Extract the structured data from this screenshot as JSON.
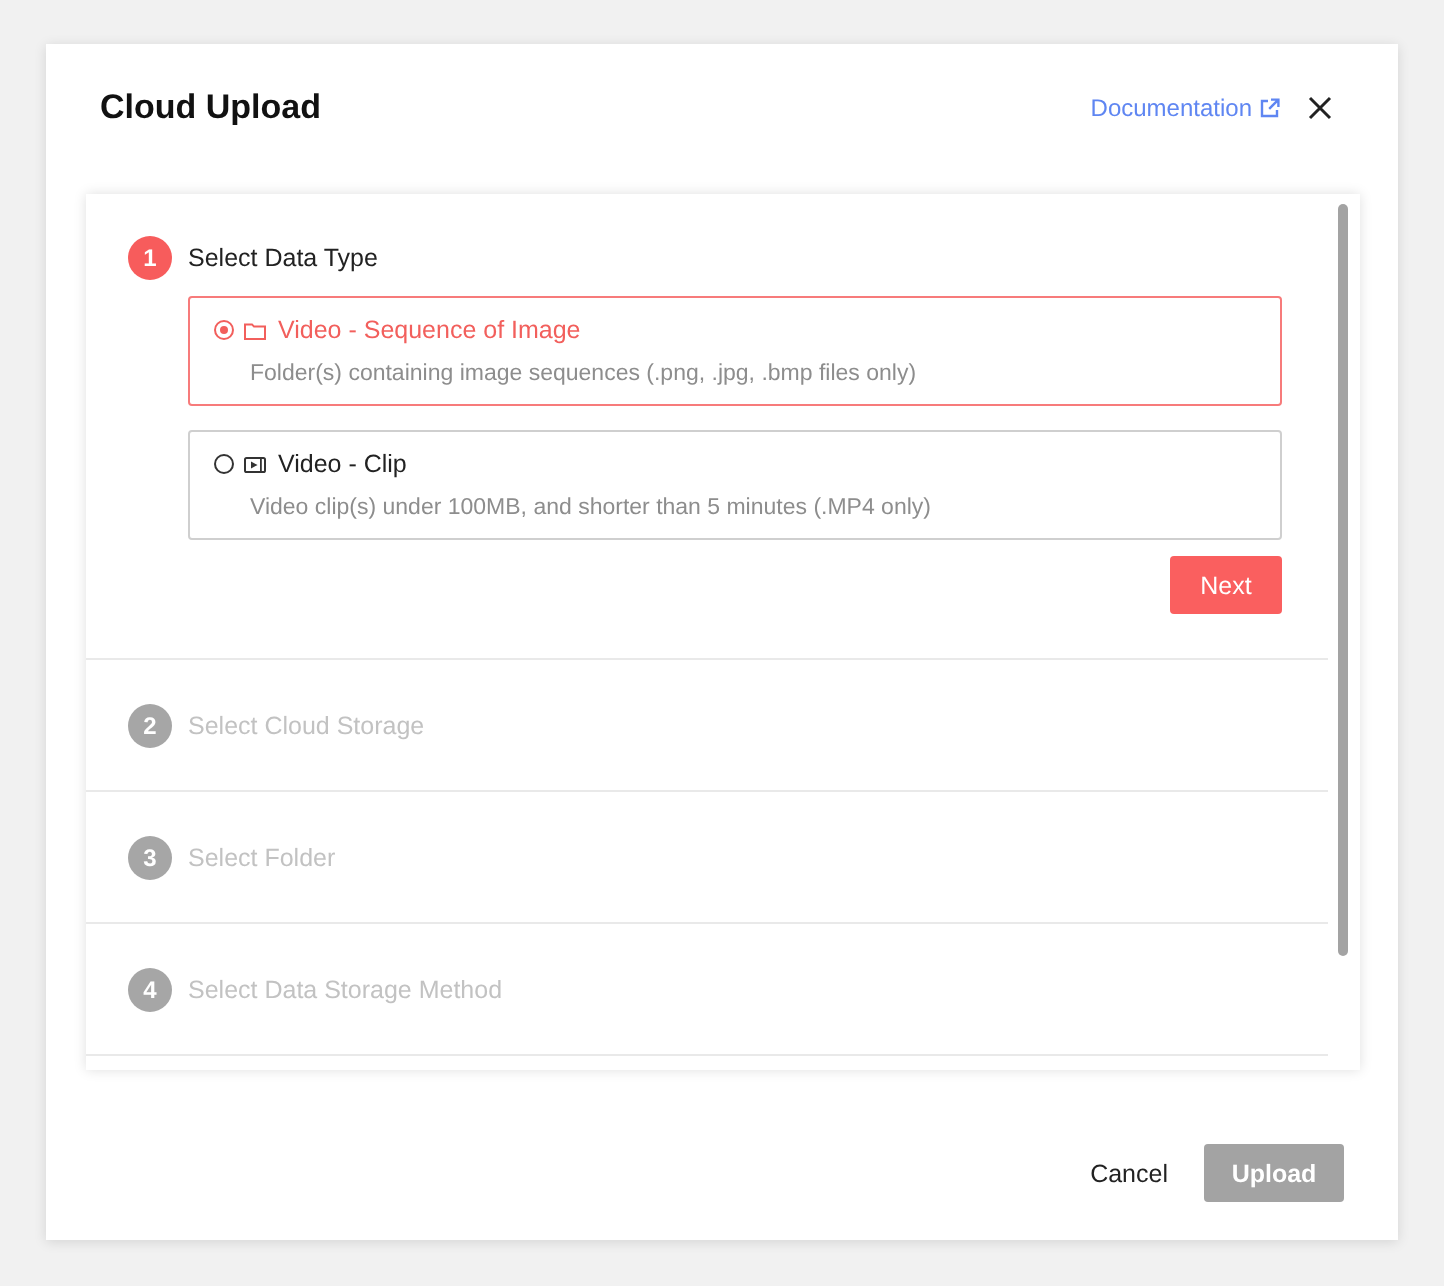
{
  "dialog": {
    "title": "Cloud Upload",
    "documentation_link": "Documentation"
  },
  "steps": [
    {
      "number": "1",
      "title": "Select Data Type",
      "active": true,
      "options": [
        {
          "kind": "folder",
          "label": "Video - Sequence of Image",
          "description": "Folder(s) containing image sequences (.png, .jpg, .bmp files only)",
          "selected": true
        },
        {
          "kind": "video",
          "label": "Video - Clip",
          "description": "Video clip(s) under 100MB, and shorter than 5 minutes (.MP4 only)",
          "selected": false
        }
      ],
      "next_button": "Next"
    },
    {
      "number": "2",
      "title": "Select Cloud Storage",
      "active": false
    },
    {
      "number": "3",
      "title": "Select Folder",
      "active": false
    },
    {
      "number": "4",
      "title": "Select Data Storage Method",
      "active": false
    }
  ],
  "footer": {
    "cancel_button": "Cancel",
    "upload_button": {
      "label": "Upload",
      "disabled": true
    }
  }
}
